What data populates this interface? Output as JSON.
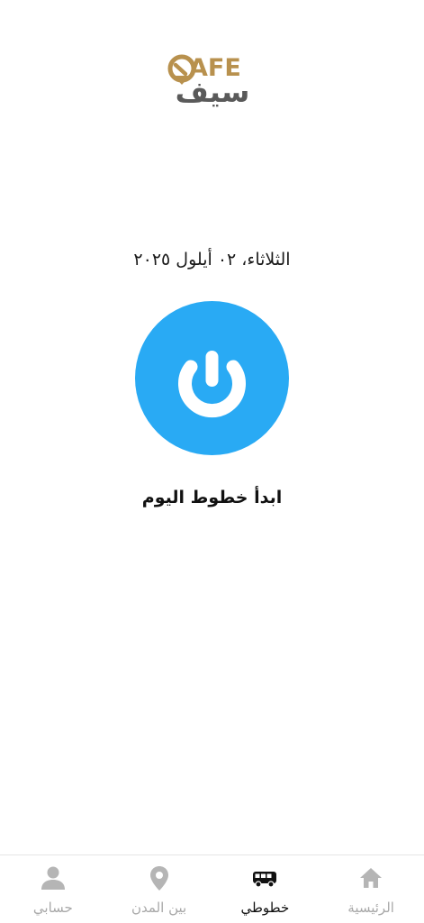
{
  "brand": {
    "logo_latin": "AFE",
    "logo_arabic": "سيف",
    "gold_color": "#b8914e",
    "gray_color": "#5a5a5a"
  },
  "main": {
    "date": "الثلاثاء، ٠٢ أيلول ٢٠٢٥",
    "start_label": "ابدأ خطوط اليوم",
    "button_color": "#29aaf4",
    "button_icon": "power-icon"
  },
  "nav": {
    "active_color": "#111111",
    "inactive_color": "#a8a8a8",
    "items": [
      {
        "label": "الرئيسية",
        "icon": "home-icon",
        "active": false
      },
      {
        "label": "خطوطي",
        "icon": "bus-icon",
        "active": true
      },
      {
        "label": "بين المدن",
        "icon": "location-pin-icon",
        "active": false
      },
      {
        "label": "حسابي",
        "icon": "user-icon",
        "active": false
      }
    ]
  }
}
